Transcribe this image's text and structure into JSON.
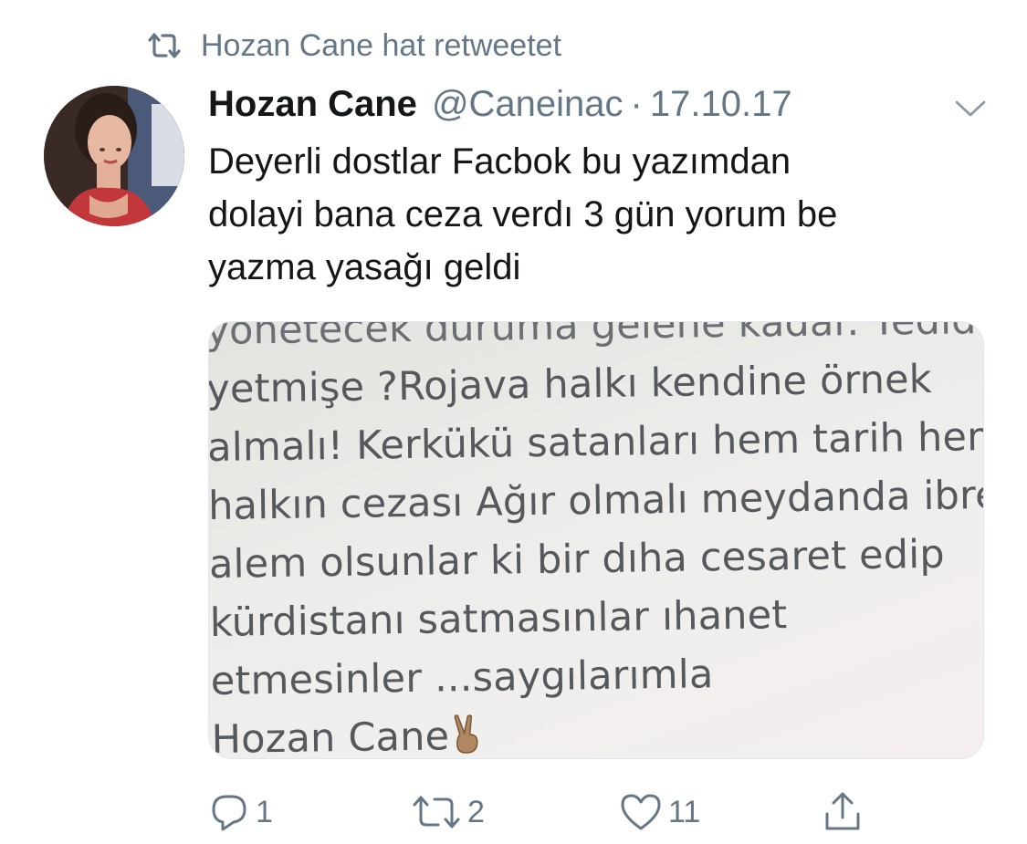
{
  "retweet_context": {
    "text": "Hozan Cane hat retweetet",
    "icon": "retweet-icon"
  },
  "tweet": {
    "author_name": "Hozan Cane",
    "handle": "@Caneinac",
    "separator": "·",
    "date": "17.10.17",
    "text_lines": [
      "Deyerli dostlar Facbok bu yazımdan",
      "dolayi bana ceza verdı 3 gün yorum be",
      "yazma yasağı geldi"
    ],
    "media_lines": [
      "yönetecek duruma gelene kadar. Yediden",
      "yetmişe ?Rojava halkı kendine örnek",
      "almalı! Kerkükü satanları hem tarih hem",
      "halkın cezası Ağır olmalı meydanda ibreti",
      "alem olsunlar ki bir dıha cesaret edip",
      "kürdistanı satmasınlar ıhanet",
      "etmesinler ...saygılarımla",
      "Hozan Cane"
    ]
  },
  "actions": {
    "reply_count": "1",
    "retweet_count": "2",
    "like_count": "11"
  },
  "colors": {
    "muted": "#657786",
    "text": "#14171a"
  }
}
